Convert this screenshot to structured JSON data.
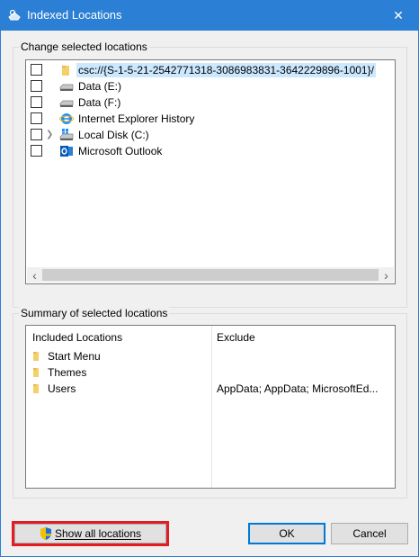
{
  "window": {
    "title": "Indexed Locations",
    "close_glyph": "✕",
    "accent_color": "#2b7fd4"
  },
  "change_group": {
    "legend": "Change selected locations",
    "items": [
      {
        "label": "csc://{S-1-5-21-2542771318-3086983831-3642229896-1001}/",
        "icon": "folder-icon",
        "checked": false,
        "selected": true
      },
      {
        "label": "Data (E:)",
        "icon": "drive-icon",
        "checked": false,
        "selected": false
      },
      {
        "label": "Data (F:)",
        "icon": "drive-icon",
        "checked": false,
        "selected": false
      },
      {
        "label": "Internet Explorer History",
        "icon": "internet-explorer-icon",
        "checked": false,
        "selected": false
      },
      {
        "label": "Local Disk (C:)",
        "icon": "windows-drive-icon",
        "checked": false,
        "selected": false,
        "expandable": true
      },
      {
        "label": "Microsoft Outlook",
        "icon": "outlook-icon",
        "checked": false,
        "selected": false
      }
    ],
    "scroll_left": "‹",
    "scroll_right": "›"
  },
  "summary_group": {
    "legend": "Summary of selected locations",
    "included_header": "Included Locations",
    "exclude_header": "Exclude",
    "rows": [
      {
        "included": "Start Menu",
        "exclude": ""
      },
      {
        "included": "Themes",
        "exclude": ""
      },
      {
        "included": "Users",
        "exclude": "AppData; AppData; MicrosoftEd..."
      }
    ]
  },
  "buttons": {
    "show_all": "Show all locations",
    "ok": "OK",
    "cancel": "Cancel"
  },
  "highlight_color": "#e31c23"
}
